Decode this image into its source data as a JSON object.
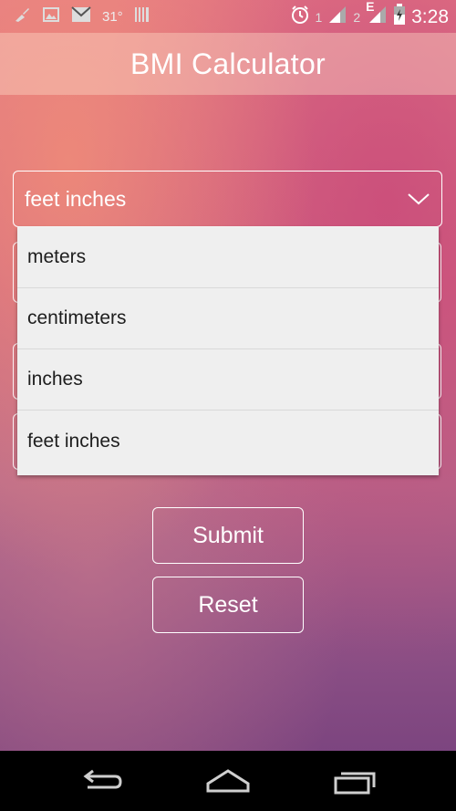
{
  "status_bar": {
    "temperature": "31°",
    "sim1_label": "1",
    "sim2_label": "2",
    "network_type": "E",
    "time": "3:28"
  },
  "app": {
    "title": "BMI Calculator"
  },
  "height_unit_spinner": {
    "selected_value": "feet inches",
    "options": [
      {
        "label": "meters"
      },
      {
        "label": "centimeters"
      },
      {
        "label": "inches"
      },
      {
        "label": "feet inches"
      }
    ]
  },
  "buttons": {
    "submit_label": "Submit",
    "reset_label": "Reset"
  },
  "colors": {
    "dropdown_bg": "#efefef",
    "text_dark": "#1e1e1e",
    "outline": "#ffffff"
  }
}
